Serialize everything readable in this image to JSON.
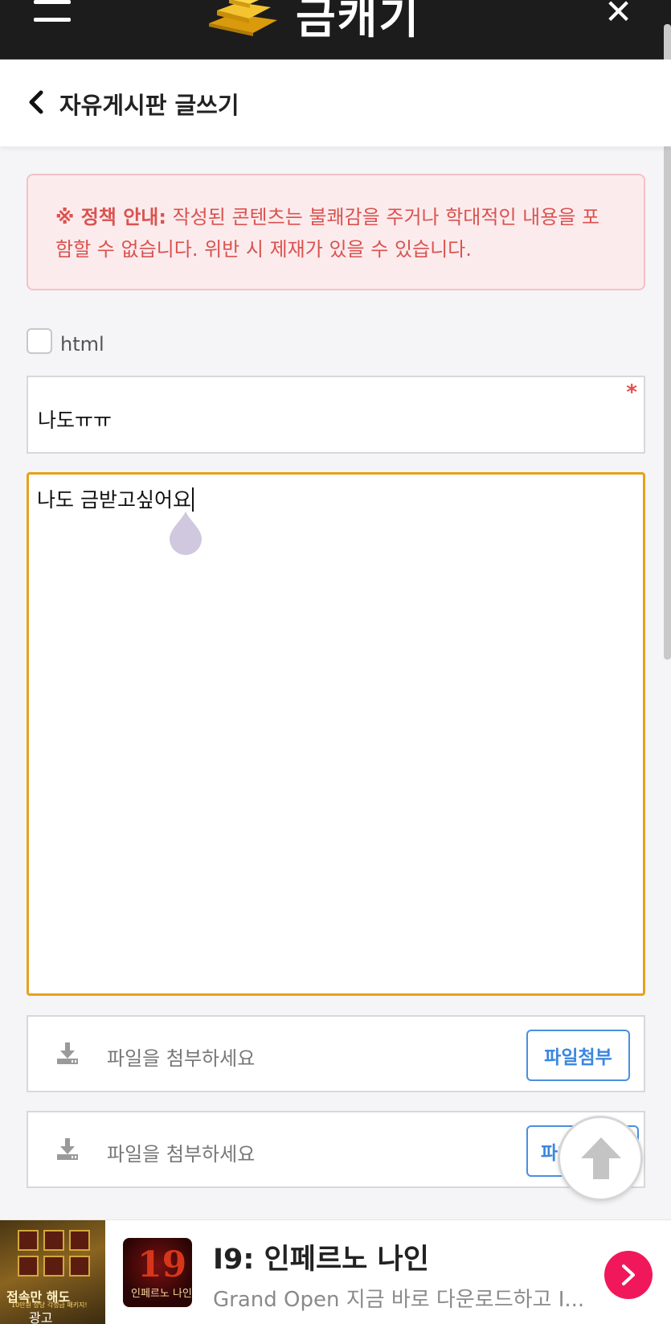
{
  "header": {
    "logo_text": "금캐기",
    "menu_icon": "hamburger-menu-icon",
    "close_icon": "close-icon"
  },
  "subheader": {
    "back_icon": "chevron-left-icon",
    "title": "자유게시판 글쓰기"
  },
  "notice": {
    "label": "※ 정책 안내:",
    "text": " 작성된 콘텐츠는 불쾌감을 주거나 학대적인 내용을 포함할 수 없습니다. 위반 시 제재가 있을 수 있습니다."
  },
  "html_option": {
    "label": "html",
    "checked": false
  },
  "form": {
    "title_value": "나도ㅠㅠ",
    "required_mark": "*",
    "content_value": "나도 금받고싶어요"
  },
  "attachments": [
    {
      "placeholder": "파일을 첨부하세요",
      "button_label": "파일첨부",
      "icon": "download-icon"
    },
    {
      "placeholder": "파일을 첨부하세요",
      "button_label": "파일첨부",
      "icon": "download-icon"
    }
  ],
  "scroll_top": {
    "icon": "arrow-up-icon"
  },
  "ad": {
    "left_headline": "접속만 해도",
    "left_sub": "10만원 상당 각성급 패키지!",
    "left_label": "광고",
    "thumb_number": "19",
    "thumb_text": "인페르노 나인",
    "title": "I9: 인페르노 나인",
    "description": "Grand Open 지금 바로 다운로드하고 I...",
    "go_icon": "chevron-right-icon"
  },
  "colors": {
    "header_bg": "#1c1c1c",
    "notice_text": "#d9534f",
    "notice_bg": "#fcebed",
    "focus_border": "#e6a21a",
    "button_blue": "#3b86e0",
    "ad_button": "#f0185a"
  }
}
